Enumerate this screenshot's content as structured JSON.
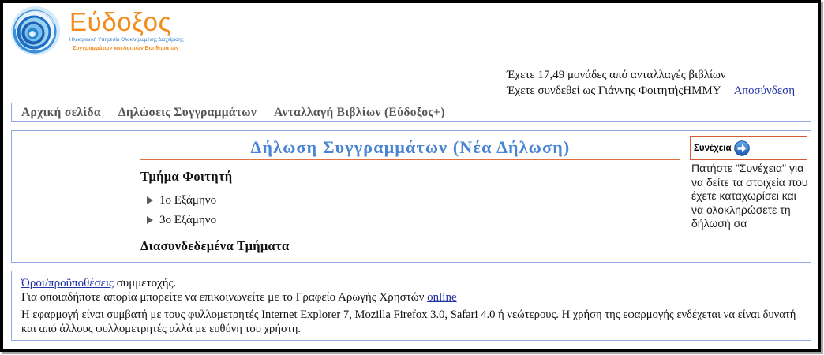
{
  "logo": {
    "icon": "eudoxus-swirl-logo-icon",
    "name": "Εύδοξος",
    "tagline_1": "Ηλεκτρονική Υπηρεσία Ολοκληρωμένης Διαχείρισης",
    "tagline_2": "Συγγραμμάτων και Λοιπών Βοηθημάτων"
  },
  "account": {
    "points_text": "Έχετε 17,49 μονάδες από ανταλλαγές βιβλίων",
    "logged_in_text": "Έχετε συνδεθεί ως Γιάννης ΦοιτητήςHMMY",
    "logout_label": "Αποσύνδεση"
  },
  "nav": {
    "items": [
      {
        "label": "Αρχική σελίδα"
      },
      {
        "label": "Δηλώσεις Συγγραμμάτων"
      },
      {
        "label": "Ανταλλαγή Βιβλίων (Εύδοξος+)"
      }
    ]
  },
  "main": {
    "title": "Δήλωση Συγγραμμάτων (Νέα Δήλωση)",
    "department_heading": "Τμήμα Φοιτητή",
    "expand_icon": "triangle-right-icon",
    "semesters": [
      {
        "label": "1ο Εξάμηνο"
      },
      {
        "label": "3ο Εξάμηνο"
      }
    ],
    "linked_heading": "Διασυνδεδεμένα Τμήματα"
  },
  "sidebar": {
    "continue_label": "Συνέχεια",
    "continue_icon": "arrow-right-circle-icon",
    "hint": "Πατήστε \"Συνέχεια\" για να δείτε τα στοιχεία που έχετε καταχωρίσει και να ολοκληρώσετε τη δήλωσή σα"
  },
  "footer": {
    "terms_link": "Όροι/προϋποθέσεις",
    "terms_suffix": " συμμετοχής.",
    "helpdesk_text": "Για οποιαδήποτε απορία μπορείτε να επικοινωνείτε με το Γραφείο Αρωγής Χρηστών ",
    "helpdesk_link": "online",
    "compat_text": "Η εφαρμογή είναι συμβατή με τους φυλλομετρητές Internet Explorer 7, Mozilla Firefox 3.0, Safari 4.0 ή νεώτερους. Η χρήση της εφαρμογής ενδέχεται να είναι δυνατή και από άλλους φυλλομετρητές αλλά με ευθύνη του χρήστη."
  },
  "colors": {
    "title_blue": "#4a84d4",
    "accent_orange": "#e0703d",
    "box_border": "#92a8e0",
    "nav_text": "#555555",
    "link_blue": "#2233a8",
    "logo_orange": "#f18c1d",
    "logo_blue": "#2b7acb",
    "continue_border": "#d65a33"
  }
}
